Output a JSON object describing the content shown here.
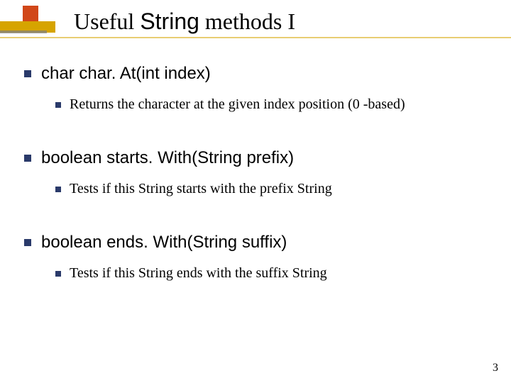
{
  "title": {
    "lead": "Useful ",
    "code": "String",
    "tail": " methods I"
  },
  "items": [
    {
      "signature": "char char. At(int index)",
      "description": "Returns the character at the given index position (0 -based)"
    },
    {
      "signature": "boolean starts. With(String prefix)",
      "description": "Tests if this String starts with the prefix String"
    },
    {
      "signature": "boolean ends. With(String suffix)",
      "description": "Tests if this String ends with the suffix String"
    }
  ],
  "page_number": "3"
}
